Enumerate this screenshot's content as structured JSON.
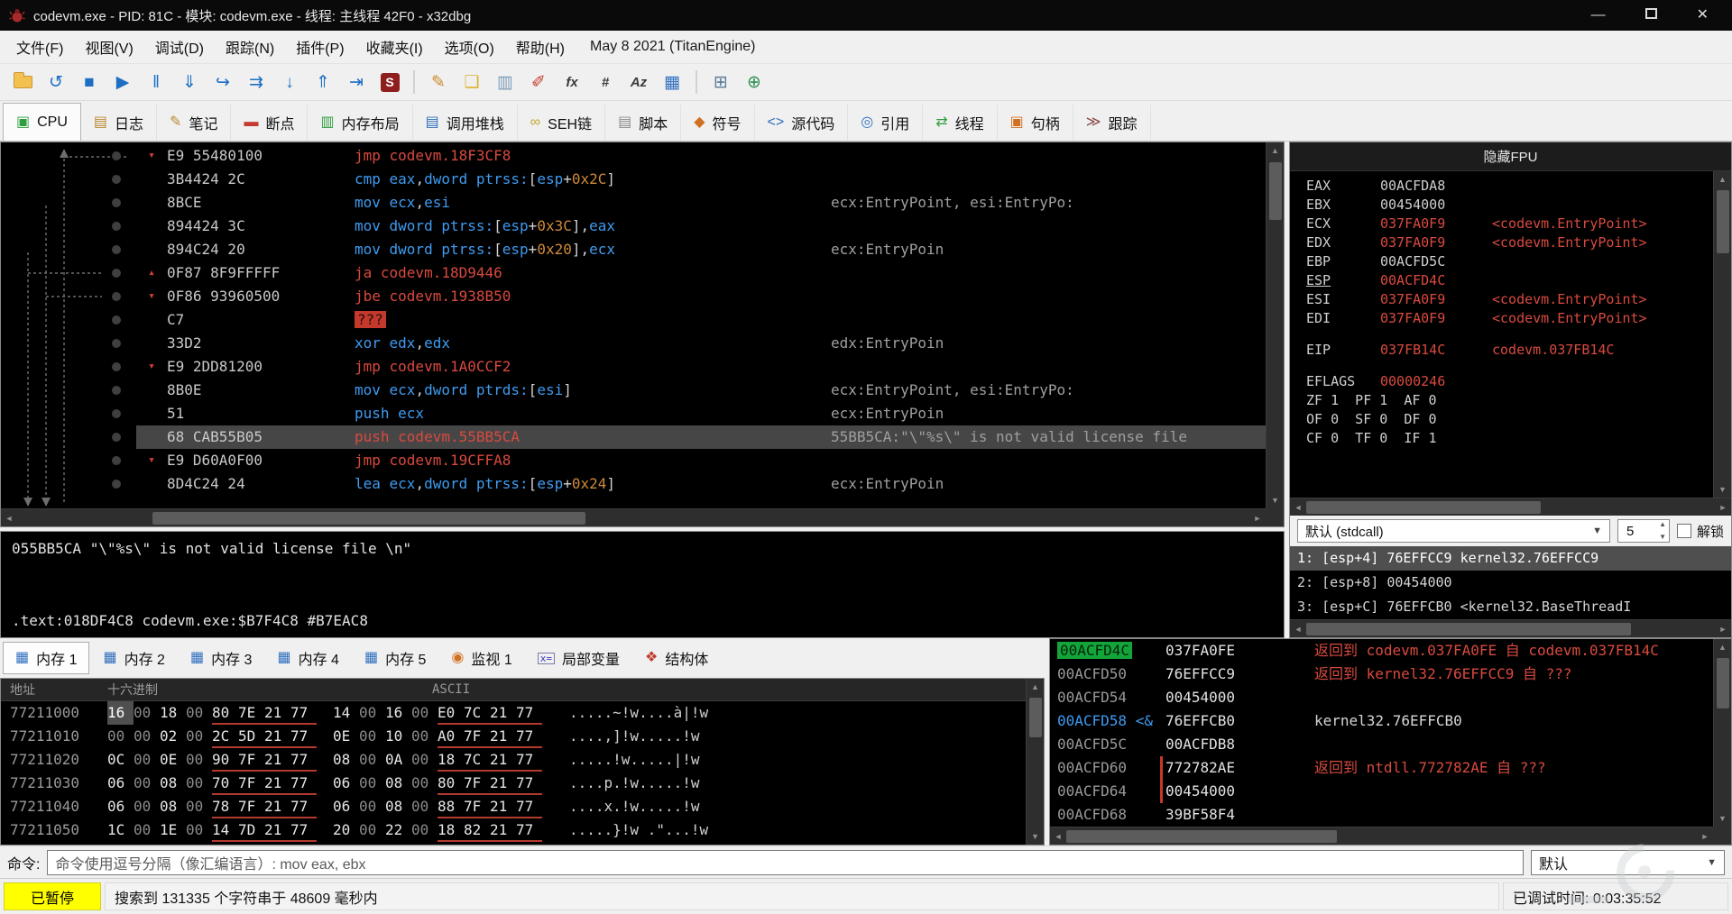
{
  "colors": {
    "accent_red": "#d84a3f",
    "accent_blue": "#3f9bf0",
    "accent_orange": "#cf8a3a",
    "panel_bg": "#000000",
    "selection": "#464646",
    "paused_yellow": "#ffff00",
    "stack_active_green": "#13a53a"
  },
  "titlebar": {
    "title": "codevm.exe - PID: 81C - 模块: codevm.exe - 线程: 主线程 42F0 - x32dbg"
  },
  "menubar": {
    "items": [
      "文件(F)",
      "视图(V)",
      "调试(D)",
      "跟踪(N)",
      "插件(P)",
      "收藏夹(I)",
      "选项(O)",
      "帮助(H)"
    ],
    "note": "May 8 2021 (TitanEngine)"
  },
  "toolbar": [
    {
      "name": "open-file",
      "type": "folder"
    },
    {
      "name": "restart",
      "glyph": "↺",
      "color": "#1d6fc4"
    },
    {
      "name": "stop",
      "glyph": "■",
      "color": "#1d6fc4"
    },
    {
      "name": "run",
      "glyph": "▶",
      "color": "#1d6fc4"
    },
    {
      "name": "pause",
      "glyph": "‖",
      "color": "#1d6fc4"
    },
    {
      "name": "step-into",
      "glyph": "⇓",
      "color": "#1d6fc4"
    },
    {
      "name": "step-over",
      "glyph": "↪",
      "color": "#1d6fc4"
    },
    {
      "name": "execute-till-return",
      "glyph": "⇉",
      "color": "#1d6fc4"
    },
    {
      "name": "step-down",
      "glyph": "↓",
      "color": "#1d6fc4"
    },
    {
      "name": "step-out",
      "glyph": "⇑",
      "color": "#1d6fc4"
    },
    {
      "name": "run-to-user-code",
      "glyph": "⇥",
      "color": "#1d6fc4"
    },
    {
      "name": "script",
      "type": "sbadge",
      "glyph": "S"
    },
    {
      "name": "sep1",
      "type": "sep"
    },
    {
      "name": "patch",
      "glyph": "✎",
      "color": "#c98a2b"
    },
    {
      "name": "fill",
      "glyph": "❏",
      "color": "#d9b32a"
    },
    {
      "name": "compare",
      "glyph": "▥",
      "color": "#7a9ab8"
    },
    {
      "name": "paint",
      "glyph": "✐",
      "color": "#c23b2e"
    },
    {
      "name": "fx",
      "type": "text",
      "glyph": "fx",
      "color": "#3a3a3a"
    },
    {
      "name": "hash",
      "type": "text",
      "glyph": "#",
      "color": "#3a3a3a"
    },
    {
      "name": "az",
      "type": "text",
      "glyph": "Az",
      "color": "#3a3a3a"
    },
    {
      "name": "memory-map-window",
      "glyph": "▦",
      "color": "#2f6fbe"
    },
    {
      "name": "sep2",
      "type": "sep"
    },
    {
      "name": "calculator",
      "glyph": "⊞",
      "color": "#5a7a9a"
    },
    {
      "name": "globe",
      "glyph": "⊕",
      "color": "#2f8f4f"
    }
  ],
  "view_tabs": [
    {
      "label": "CPU",
      "icon": "▣",
      "icon_name": "cpu-icon",
      "color": "#2f9e3f",
      "active": true
    },
    {
      "label": "日志",
      "icon": "▤",
      "icon_name": "log-icon",
      "color": "#b98a2f",
      "active": false
    },
    {
      "label": "笔记",
      "icon": "✎",
      "icon_name": "notes-icon",
      "color": "#b98a2f",
      "active": false
    },
    {
      "label": "断点",
      "icon": "▬",
      "icon_name": "breakpoints-icon",
      "color": "#c23b2e",
      "active": false
    },
    {
      "label": "内存布局",
      "icon": "▥",
      "icon_name": "memory-map-icon",
      "color": "#2f9e3f",
      "active": false
    },
    {
      "label": "调用堆栈",
      "icon": "▤",
      "icon_name": "call-stack-icon",
      "color": "#2f6fbe",
      "active": false
    },
    {
      "label": "SEH链",
      "icon": "∞",
      "icon_name": "seh-chain-icon",
      "color": "#c2a52e",
      "active": false
    },
    {
      "label": "脚本",
      "icon": "▤",
      "icon_name": "script-icon",
      "color": "#8a8a8a",
      "active": false
    },
    {
      "label": "符号",
      "icon": "◆",
      "icon_name": "symbols-icon",
      "color": "#d07020",
      "active": false
    },
    {
      "label": "源代码",
      "icon": "<>",
      "icon_name": "source-icon",
      "color": "#2f6fbe",
      "active": false
    },
    {
      "label": "引用",
      "icon": "◎",
      "icon_name": "references-icon",
      "color": "#2f6fbe",
      "active": false
    },
    {
      "label": "线程",
      "icon": "⇄",
      "icon_name": "threads-icon",
      "color": "#2f9e3f",
      "active": false
    },
    {
      "label": "句柄",
      "icon": "▣",
      "icon_name": "handles-icon",
      "color": "#d07020",
      "active": false
    },
    {
      "label": "跟踪",
      "icon": "≫",
      "icon_name": "trace-icon",
      "color": "#8a4a4a",
      "active": false
    }
  ],
  "disasm": {
    "rows": [
      {
        "marker": "down",
        "bytes": "E9 55480100",
        "segs": [
          [
            "r",
            "jmp codevm.18F3CF8"
          ]
        ],
        "comment": ""
      },
      {
        "marker": "",
        "bytes": "3B4424 2C",
        "segs": [
          [
            "b",
            "cmp eax"
          ],
          [
            "w",
            ","
          ],
          [
            "b",
            "dword ptrss:"
          ],
          [
            "w",
            "["
          ],
          [
            "b",
            "esp"
          ],
          [
            "w",
            "+"
          ],
          [
            "o",
            "0x2C"
          ],
          [
            "w",
            "]"
          ]
        ],
        "comment": ""
      },
      {
        "marker": "",
        "bytes": "8BCE",
        "segs": [
          [
            "b",
            "mov ecx"
          ],
          [
            "w",
            ","
          ],
          [
            "b",
            "esi"
          ]
        ],
        "comment": "ecx:EntryPoint, esi:EntryPo:"
      },
      {
        "marker": "",
        "bytes": "894424 3C",
        "segs": [
          [
            "b",
            "mov dword ptrss:"
          ],
          [
            "w",
            "["
          ],
          [
            "b",
            "esp"
          ],
          [
            "w",
            "+"
          ],
          [
            "o",
            "0x3C"
          ],
          [
            "w",
            "]"
          ],
          [
            "w",
            ","
          ],
          [
            "b",
            "eax"
          ]
        ],
        "comment": ""
      },
      {
        "marker": "",
        "bytes": "894C24 20",
        "segs": [
          [
            "b",
            "mov dword ptrss:"
          ],
          [
            "w",
            "["
          ],
          [
            "b",
            "esp"
          ],
          [
            "w",
            "+"
          ],
          [
            "o",
            "0x20"
          ],
          [
            "w",
            "]"
          ],
          [
            "w",
            ","
          ],
          [
            "b",
            "ecx"
          ]
        ],
        "comment": "ecx:EntryPoin"
      },
      {
        "marker": "up",
        "bytes": "0F87 8F9FFFFF",
        "segs": [
          [
            "r",
            "ja codevm.18D9446"
          ]
        ],
        "comment": ""
      },
      {
        "marker": "down",
        "bytes": "0F86 93960500",
        "segs": [
          [
            "r",
            "jbe codevm.1938B50"
          ]
        ],
        "comment": ""
      },
      {
        "marker": "",
        "bytes": "C7",
        "segs": [
          [
            "q",
            "???"
          ]
        ],
        "comment": ""
      },
      {
        "marker": "",
        "bytes": "33D2",
        "segs": [
          [
            "b",
            "xor edx"
          ],
          [
            "w",
            ","
          ],
          [
            "b",
            "edx"
          ]
        ],
        "comment": "edx:EntryPoin"
      },
      {
        "marker": "down",
        "bytes": "E9 2DD81200",
        "segs": [
          [
            "r",
            "jmp codevm.1A0CCF2"
          ]
        ],
        "comment": ""
      },
      {
        "marker": "",
        "bytes": "8B0E",
        "segs": [
          [
            "b",
            "mov ecx"
          ],
          [
            "w",
            ","
          ],
          [
            "b",
            "dword ptrds:"
          ],
          [
            "w",
            "["
          ],
          [
            "b",
            "esi"
          ],
          [
            "w",
            "]"
          ]
        ],
        "comment": "ecx:EntryPoint, esi:EntryPo:"
      },
      {
        "marker": "",
        "bytes": "51",
        "segs": [
          [
            "b",
            "push ecx"
          ]
        ],
        "comment": "ecx:EntryPoin"
      },
      {
        "marker": "",
        "selected": true,
        "bytes": "68 CAB55B05",
        "segs": [
          [
            "r",
            "push codevm.55BB5CA"
          ]
        ],
        "comment": "55BB5CA:\"\\\"%s\\\" is not valid license file"
      },
      {
        "marker": "down",
        "bytes": "E9 D60A0F00",
        "segs": [
          [
            "r",
            "jmp codevm.19CFFA8"
          ]
        ],
        "comment": ""
      },
      {
        "marker": "",
        "bytes": "8D4C24 24",
        "segs": [
          [
            "b",
            "lea ecx"
          ],
          [
            "w",
            ","
          ],
          [
            "b",
            "dword ptrss:"
          ],
          [
            "w",
            "["
          ],
          [
            "b",
            "esp"
          ],
          [
            "w",
            "+"
          ],
          [
            "o",
            "0x24"
          ],
          [
            "w",
            "]"
          ]
        ],
        "comment": "ecx:EntryPoin"
      }
    ]
  },
  "infobox": {
    "line1": "055BB5CA \"\\\"%s\\\" is not valid license file \\n\"",
    "line2": ".text:018DF4C8 codevm.exe:$B7F4C8 #B7EAC8"
  },
  "registers": {
    "header": "隐藏FPU",
    "rows": [
      {
        "name": "EAX",
        "value": "00ACFDA8"
      },
      {
        "name": "EBX",
        "value": "00454000"
      },
      {
        "name": "ECX",
        "value": "037FA0F9",
        "changed": true,
        "extra": "<codevm.EntryPoint>"
      },
      {
        "name": "EDX",
        "value": "037FA0F9",
        "changed": true,
        "extra": "<codevm.EntryPoint>"
      },
      {
        "name": "EBP",
        "value": "00ACFD5C"
      },
      {
        "name": "ESP",
        "value": "00ACFD4C",
        "changed": true,
        "underline": true
      },
      {
        "name": "ESI",
        "value": "037FA0F9",
        "changed": true,
        "extra": "<codevm.EntryPoint>"
      },
      {
        "name": "EDI",
        "value": "037FA0F9",
        "changed": true,
        "extra": "<codevm.EntryPoint>"
      },
      {
        "gap": true
      },
      {
        "name": "EIP",
        "value": "037FB14C",
        "changed": true,
        "extra": "codevm.037FB14C"
      },
      {
        "gap": true
      },
      {
        "name": "EFLAGS",
        "value": "00000246",
        "changed": true
      },
      {
        "flags": "ZF 1  PF 1  AF 0"
      },
      {
        "flags": "OF 0  SF 0  DF 0"
      },
      {
        "flags": "CF 0  TF 0  IF 1"
      }
    ]
  },
  "callinfo": {
    "convention": "默认 (stdcall)",
    "depth": "5",
    "unlock": "解锁",
    "args": [
      {
        "text": "1: [esp+4] 76EFFCC9 kernel32.76EFFCC9",
        "selected": true
      },
      {
        "text": "2: [esp+8] 00454000",
        "selected": false
      },
      {
        "text": "3: [esp+C] 76EFFCB0 <kernel32.BaseThreadI",
        "selected": false
      }
    ]
  },
  "bottom_tabs": [
    {
      "label": "内存 1",
      "icon": "▦",
      "icon_name": "memory1-icon",
      "color": "#2f6fbe",
      "active": true,
      "boxed": false
    },
    {
      "label": "内存 2",
      "icon": "▦",
      "icon_name": "memory2-icon",
      "color": "#2f6fbe",
      "active": false,
      "boxed": false
    },
    {
      "label": "内存 3",
      "icon": "▦",
      "icon_name": "memory3-icon",
      "color": "#2f6fbe",
      "active": false,
      "boxed": false
    },
    {
      "label": "内存 4",
      "icon": "▦",
      "icon_name": "memory4-icon",
      "color": "#2f6fbe",
      "active": false,
      "boxed": false
    },
    {
      "label": "内存 5",
      "icon": "▦",
      "icon_name": "memory5-icon",
      "color": "#2f6fbe",
      "active": false,
      "boxed": false
    },
    {
      "label": "监视 1",
      "icon": "◉",
      "icon_name": "watch1-icon",
      "color": "#d07020",
      "active": false,
      "boxed": false
    },
    {
      "label": "局部变量",
      "icon": "x=",
      "icon_name": "locals-icon",
      "color": "#3a3ac0",
      "active": false,
      "boxed": true
    },
    {
      "label": "结构体",
      "icon": "❖",
      "icon_name": "struct-icon",
      "color": "#c23b2e",
      "active": false,
      "boxed": false
    }
  ],
  "memory": {
    "headers": [
      "地址",
      "十六进制",
      "ASCII"
    ],
    "rows": [
      {
        "addr": "77211000",
        "g1": [
          "16",
          "00",
          "18",
          "00",
          "80",
          "7E",
          "21",
          "77"
        ],
        "g2": [
          "14",
          "00",
          "16",
          "00",
          "E0",
          "7C",
          "21",
          "77"
        ],
        "ascii": ".....~!w....à|!w"
      },
      {
        "addr": "77211010",
        "g1": [
          "00",
          "00",
          "02",
          "00",
          "2C",
          "5D",
          "21",
          "77"
        ],
        "g2": [
          "0E",
          "00",
          "10",
          "00",
          "A0",
          "7F",
          "21",
          "77"
        ],
        "ascii": "....,]!w.....!w"
      },
      {
        "addr": "77211020",
        "g1": [
          "0C",
          "00",
          "0E",
          "00",
          "90",
          "7F",
          "21",
          "77"
        ],
        "g2": [
          "08",
          "00",
          "0A",
          "00",
          "18",
          "7C",
          "21",
          "77"
        ],
        "ascii": ".....!w.....|!w"
      },
      {
        "addr": "77211030",
        "g1": [
          "06",
          "00",
          "08",
          "00",
          "70",
          "7F",
          "21",
          "77"
        ],
        "g2": [
          "06",
          "00",
          "08",
          "00",
          "80",
          "7F",
          "21",
          "77"
        ],
        "ascii": "....p.!w.....!w"
      },
      {
        "addr": "77211040",
        "g1": [
          "06",
          "00",
          "08",
          "00",
          "78",
          "7F",
          "21",
          "77"
        ],
        "g2": [
          "06",
          "00",
          "08",
          "00",
          "88",
          "7F",
          "21",
          "77"
        ],
        "ascii": "....x.!w.....!w"
      },
      {
        "addr": "77211050",
        "g1": [
          "1C",
          "00",
          "1E",
          "00",
          "14",
          "7D",
          "21",
          "77"
        ],
        "g2": [
          "20",
          "00",
          "22",
          "00",
          "18",
          "82",
          "21",
          "77"
        ],
        "ascii": ".....}!w .\"...!w"
      }
    ]
  },
  "stack": {
    "rows": [
      {
        "addr": "00ACFD4C",
        "addr_style": "active",
        "value": "037FA0FE",
        "comment": "返回到 codevm.037FA0FE 自 codevm.037FB14C",
        "comment_color": "red",
        "bracket": false
      },
      {
        "addr": "00ACFD50",
        "addr_style": "",
        "value": "76EFFCC9",
        "comment": "返回到 kernel32.76EFFCC9 自 ???",
        "comment_color": "red",
        "bracket": false
      },
      {
        "addr": "00ACFD54",
        "addr_style": "",
        "value": "00454000",
        "comment": "",
        "comment_color": "",
        "bracket": false
      },
      {
        "addr": "00ACFD58",
        "addr_style": "blue",
        "addr_suffix": "<&",
        "value": "76EFFCB0",
        "comment": "kernel32.76EFFCB0",
        "comment_color": "white",
        "bracket": false
      },
      {
        "addr": "00ACFD5C",
        "addr_style": "",
        "value": "00ACFDB8",
        "comment": "",
        "comment_color": "",
        "bracket": false
      },
      {
        "addr": "00ACFD60",
        "addr_style": "",
        "value": "772782AE",
        "comment": "返回到 ntdll.772782AE 自 ???",
        "comment_color": "red",
        "bracket": true
      },
      {
        "addr": "00ACFD64",
        "addr_style": "",
        "value": "00454000",
        "comment": "",
        "comment_color": "",
        "bracket": true
      },
      {
        "addr": "00ACFD68",
        "addr_style": "",
        "value": "39BF58F4",
        "comment": "",
        "comment_color": "",
        "bracket": false
      }
    ]
  },
  "cmdbar": {
    "label": "命令:",
    "text": "命令使用逗号分隔（像汇编语言）: mov eax, ebx",
    "profile": "默认"
  },
  "status": {
    "state": "已暂停",
    "message": "搜索到 131335 个字符串于 48609 毫秒内",
    "time": "已调试时间:  0:03:35:52"
  }
}
